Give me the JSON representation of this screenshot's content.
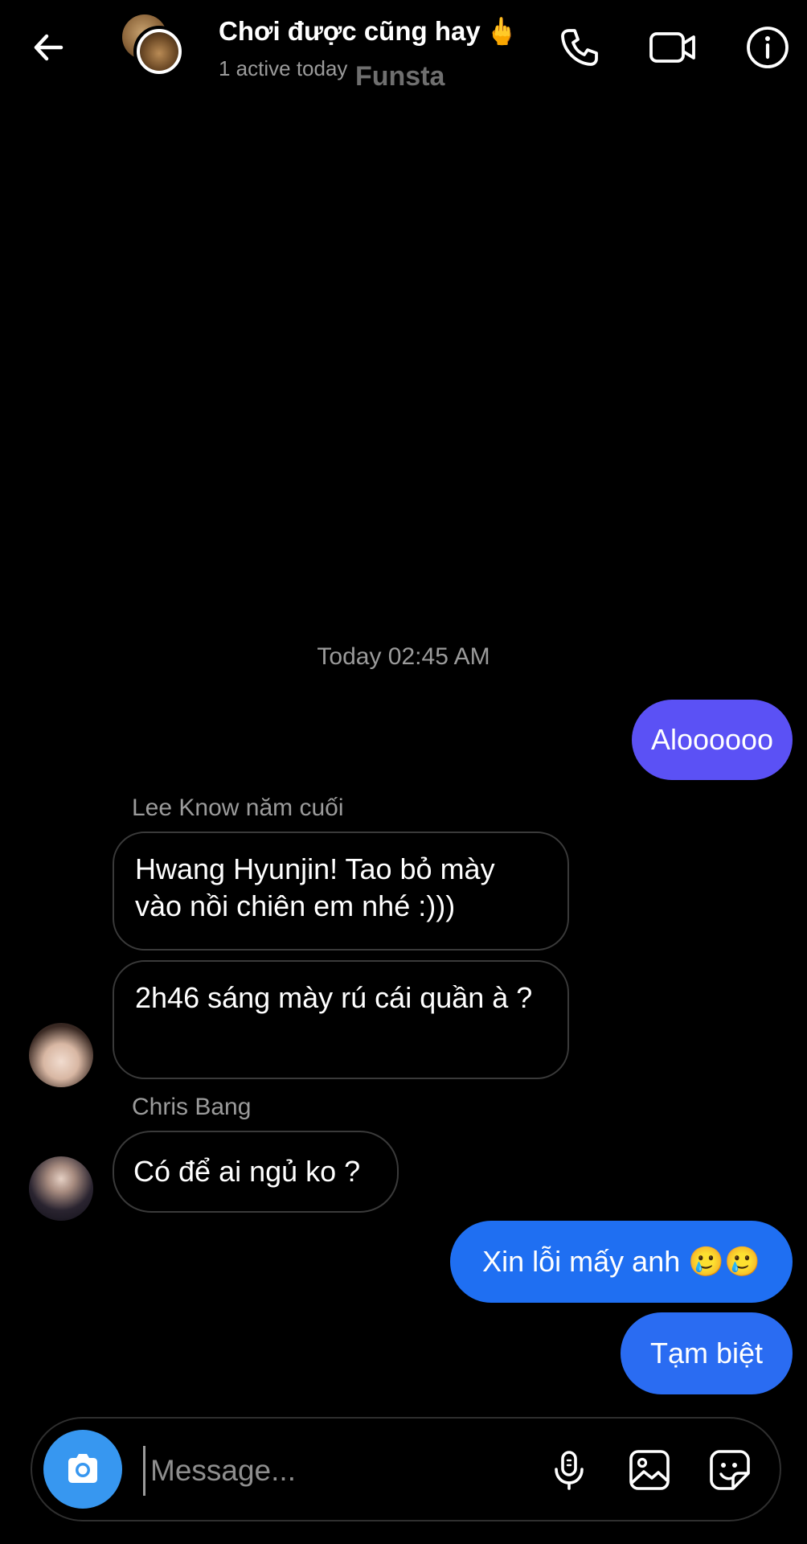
{
  "header": {
    "group_title": "Chơi được cũng hay",
    "title_emoji": "🖕",
    "active_status": "1 active today",
    "app_watermark": "Funsta"
  },
  "thread": {
    "timestamp": "Today 02:45 AM",
    "messages": [
      {
        "sender": "me",
        "text": "Aloooooo"
      },
      {
        "sender": "Lee Know năm cuối",
        "text": "Hwang Hyunjin! Tao bỏ mày vào nồi chiên em nhé :)))"
      },
      {
        "sender": "Lee Know năm cuối",
        "text": "2h46 sáng mày rú cái quần à ?"
      },
      {
        "sender": "Chris Bang",
        "text": "Có để ai ngủ ko ?"
      },
      {
        "sender": "me",
        "text": "Xin lỗi mấy anh 🥲🥲"
      },
      {
        "sender": "me",
        "text": "Tạm biệt"
      }
    ],
    "senders": {
      "lee_know": "Lee Know năm cuối",
      "chris": "Chris Bang"
    }
  },
  "composer": {
    "placeholder": "Message..."
  },
  "colors": {
    "bubble_purple": "#5b51f5",
    "bubble_blue": "#1f6ff2",
    "camera_blue": "#3797f0",
    "background": "#000000"
  },
  "icons": [
    "back-arrow-icon",
    "phone-icon",
    "video-camera-icon",
    "info-icon",
    "camera-icon",
    "microphone-icon",
    "gallery-icon",
    "sticker-icon"
  ]
}
